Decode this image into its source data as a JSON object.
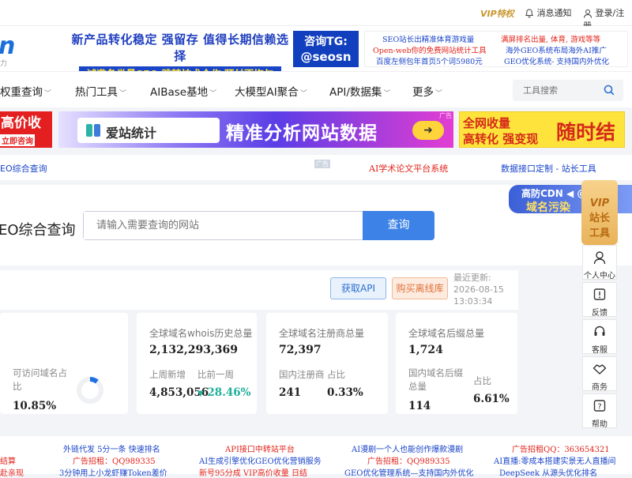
{
  "topbar": {
    "vip_label": "VIP特权",
    "notice_label": "消息通知",
    "login_label": "登录/注册"
  },
  "header": {
    "logo_fragment": "n",
    "logo_sub": "力",
    "banner1_line1": "新产品转化稳定 强留存 值得长期信赖选择",
    "banner1_line2": "诚邀各类量SEO 跳转技术合作 预付不拖欠",
    "banner2_line1": "咨询TG:",
    "banner2_line2": "@seosn",
    "banner3_rows": [
      {
        "left": "SEO站长出精准体育游戏量",
        "right": "满屏排名出量, 体育, 游戏等等"
      },
      {
        "left": "Open-web你的免费网站统计工具",
        "right": "海外GEO系统布局海外AI推广"
      },
      {
        "left": "百度左侧包年首页5个词5980元",
        "right": "GEO优化系统- 支持国内外优化"
      }
    ]
  },
  "nav": {
    "items": [
      {
        "label": "权重查询"
      },
      {
        "label": "热门工具"
      },
      {
        "label": "AIBase基地"
      },
      {
        "label": "大模型AI聚合"
      },
      {
        "label": "API/数据集"
      },
      {
        "label": "更多"
      }
    ],
    "search_placeholder": "工具搜索"
  },
  "ads": {
    "left_line1": "高价收",
    "left_line2": "立即咨询",
    "mid_pill": "爱站统计",
    "mid_big": "精准分析网站数据",
    "mid_arrow": "➜",
    "mid_tag": "广告",
    "right_line1": "全网收量",
    "right_line2": "高转化 强变现",
    "right_big": "随时结"
  },
  "linkrow": {
    "left": "EO综合查询",
    "tag": "广告",
    "mid": "AI学术论文平台系统",
    "right": "数据接口定制 - 站长工具"
  },
  "query": {
    "title": "EO综合查询",
    "placeholder": "请输入需要查询的网站",
    "button": "查询",
    "cdn_line1": "高防CDN ◀ @C14",
    "cdn_line2": "域名污染"
  },
  "stats": {
    "api_button": "获取API",
    "offline_button": "购买离线库",
    "updated_label": "最近更新:",
    "updated_date": "2026-08-15",
    "updated_time": "13:03:34",
    "accessible_label": "可访问域名占比",
    "accessible_value": "10.85%",
    "accessible_fraction": 0.1085,
    "cards": [
      {
        "label": "全球域名whois历史总量",
        "value": "2,132,293,369",
        "sub1_label": "上周新增",
        "sub1_value": "4,853,056",
        "sub2_label": "比前一周",
        "sub2_value": "28.46%"
      },
      {
        "label": "全球域名注册商总量",
        "value": "72,397",
        "sub1_label": "国内注册商",
        "sub1_value": "241",
        "sub2_label": "占比",
        "sub2_value": "0.33%"
      },
      {
        "label": "全球域名后缀总量",
        "value": "1,724",
        "sub1_label": "国内域名后缀总量",
        "sub1_value": "114",
        "sub2_label": "占比",
        "sub2_value": "6.61%"
      }
    ]
  },
  "side": {
    "vip_l1": "VIP",
    "vip_l2": "站长",
    "vip_l3": "工具",
    "buttons": [
      {
        "label": "个人中心",
        "icon": "user-icon"
      },
      {
        "label": "反馈",
        "icon": "feedback-icon"
      },
      {
        "label": "客服",
        "icon": "headset-icon"
      },
      {
        "label": "商务",
        "icon": "handshake-icon"
      },
      {
        "label": "帮助",
        "icon": "help-icon"
      }
    ]
  },
  "bottom": {
    "col1": [
      "结算",
      "赴亲现"
    ],
    "col2": [
      "外链代发 5分一条 快速排名",
      "广告招租：QQ989335",
      "3分钟用上小龙虾赚Token差价"
    ],
    "col3": [
      "API接口中转站平台",
      "AI生成引擎优化GEO优化营销服务",
      "新号95分成 VIP高价收量 日结"
    ],
    "col4": [
      "AI漫剧一个人也能创作爆款漫剧",
      "广告招租：QQ989335",
      "GEO优化管理系统—支持国内外优化"
    ],
    "col5": [
      "广告招租QQ：363654321",
      "AI直播:零成本搭建实景无人直播间",
      "DeepSeek 从源头优化排名"
    ]
  }
}
